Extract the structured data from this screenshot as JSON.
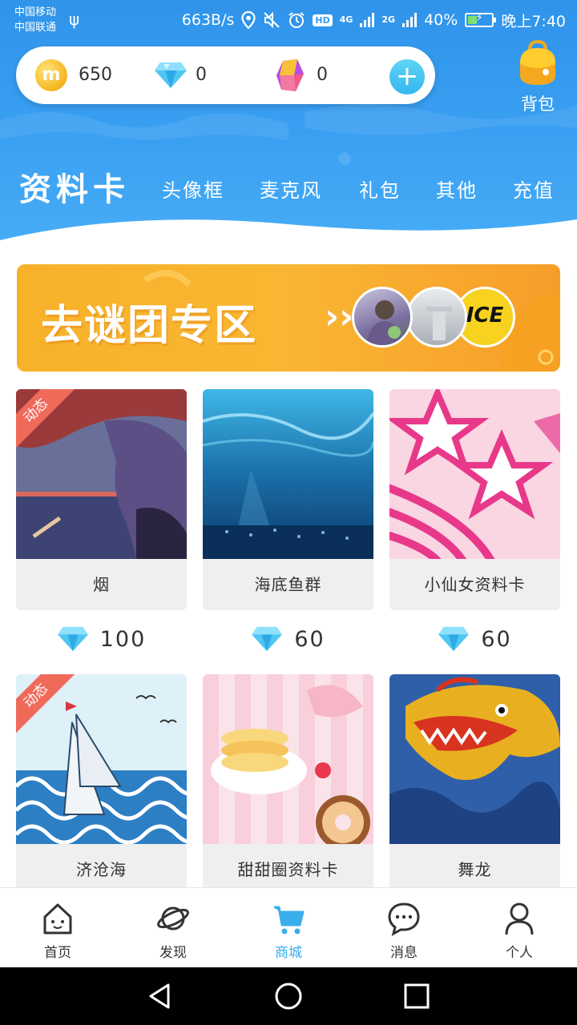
{
  "status_bar": {
    "carrier1": "中国移动",
    "carrier2": "中国联通",
    "net_speed": "663B/s",
    "net_4g": "4G",
    "net_2g": "2G",
    "battery": "40%",
    "battery_level": 0.4,
    "time": "晚上7:40",
    "icons": [
      "usb-icon",
      "location-icon",
      "mute-icon",
      "alarm-icon",
      "hd-icon",
      "signal-icon",
      "battery-icon"
    ]
  },
  "wallet": {
    "coins": "650",
    "diamonds": "0",
    "gems": "0",
    "coin_glyph": "m",
    "add_label": "+"
  },
  "bag": {
    "label": "背包"
  },
  "tabs": [
    {
      "label": "资料卡",
      "active": true
    },
    {
      "label": "头像框"
    },
    {
      "label": "麦克风"
    },
    {
      "label": "礼包"
    },
    {
      "label": "其他"
    },
    {
      "label": "充值"
    }
  ],
  "banner": {
    "text": "去谜团专区",
    "arrow": "›››",
    "avatar3_text": "ICE"
  },
  "products": [
    {
      "name": "烟",
      "price": "100",
      "badge": "动态"
    },
    {
      "name": "海底鱼群",
      "price": "60"
    },
    {
      "name": "小仙女资料卡",
      "price": "60"
    },
    {
      "name": "济沧海",
      "badge": "动态"
    },
    {
      "name": "甜甜圈资料卡"
    },
    {
      "name": "舞龙"
    }
  ],
  "bottom_nav": [
    {
      "label": "首页",
      "icon": "home-icon"
    },
    {
      "label": "发现",
      "icon": "planet-icon"
    },
    {
      "label": "商城",
      "icon": "cart-icon",
      "active": true
    },
    {
      "label": "消息",
      "icon": "chat-icon"
    },
    {
      "label": "个人",
      "icon": "person-icon"
    }
  ],
  "colors": {
    "header_blue": "#3a9ff0",
    "accent": "#3aaeea",
    "banner_orange": "#f7b22a",
    "badge_red": "#f06a5a"
  }
}
